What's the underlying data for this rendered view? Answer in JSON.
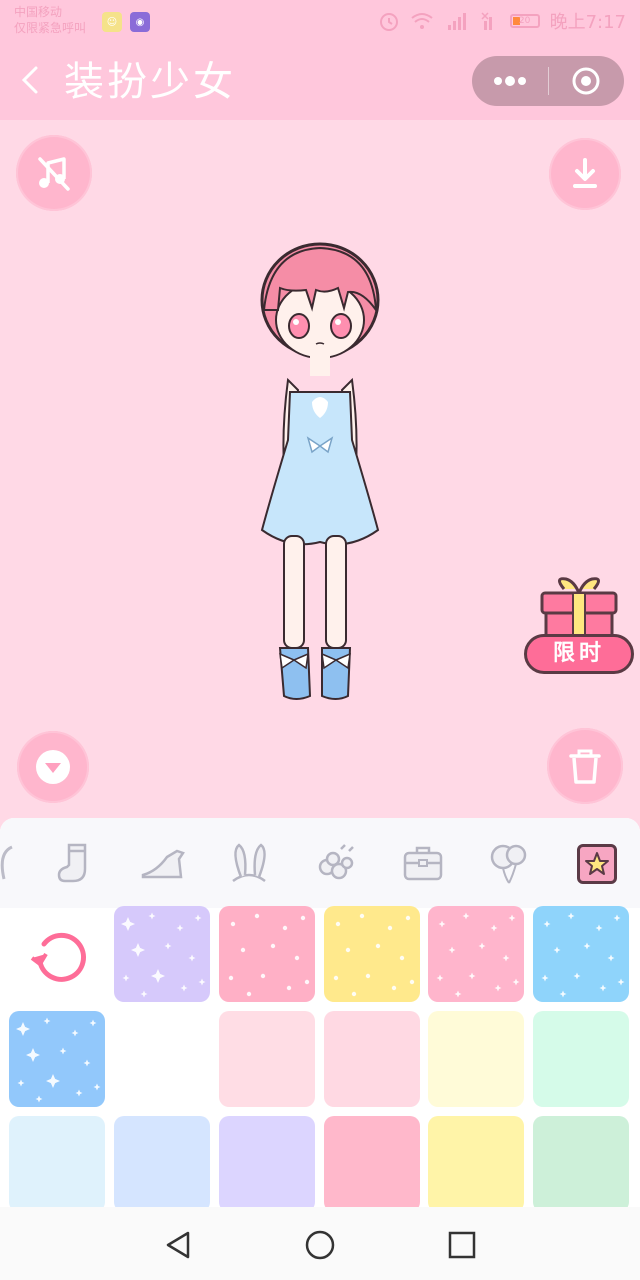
{
  "status_bar": {
    "carrier_line1": "中国移动",
    "carrier_line2": "仅限紧急呼叫",
    "signal_label": "4G",
    "battery_level": "20",
    "time": "晚上7:17"
  },
  "title_bar": {
    "title": "装扮少女"
  },
  "gift": {
    "label": "限时"
  },
  "categories": [
    {
      "name": "hair-icon"
    },
    {
      "name": "socks-icon"
    },
    {
      "name": "shoes-icon"
    },
    {
      "name": "bunny-ears-icon"
    },
    {
      "name": "flower-accessory-icon"
    },
    {
      "name": "bag-icon"
    },
    {
      "name": "balloon-icon"
    },
    {
      "name": "background-icon",
      "selected": true
    }
  ],
  "colors": {
    "accent": "#fe6d98",
    "bg": "#ffd9e6",
    "titlebar": "#ffc7dc"
  },
  "background_tiles": [
    {
      "color": "#d6c9fb",
      "pattern": "stars"
    },
    {
      "color": "#ffb0c6",
      "pattern": "dots"
    },
    {
      "color": "#ffe98c",
      "pattern": "dots"
    },
    {
      "color": "#ffb5cc",
      "pattern": "sparkles"
    },
    {
      "color": "#8fd4fb",
      "pattern": "sparkles"
    },
    {
      "color": "#92c8fb",
      "pattern": "stars"
    },
    {
      "color": "#ffffff",
      "pattern": "none"
    },
    {
      "color": "#ffdde5",
      "pattern": "none"
    },
    {
      "color": "#ffd9e3",
      "pattern": "none"
    },
    {
      "color": "#fffbd8",
      "pattern": "none"
    },
    {
      "color": "#d5fbe9",
      "pattern": "none"
    },
    {
      "color": "#dff2fc",
      "pattern": "none"
    },
    {
      "color": "#d5e5ff",
      "pattern": "none"
    },
    {
      "color": "#dcd5ff",
      "pattern": "none"
    },
    {
      "color": "#ffb8cb",
      "pattern": "none"
    },
    {
      "color": "#fff4a8",
      "pattern": "none"
    },
    {
      "color": "#cdf0d9",
      "pattern": "none"
    }
  ]
}
